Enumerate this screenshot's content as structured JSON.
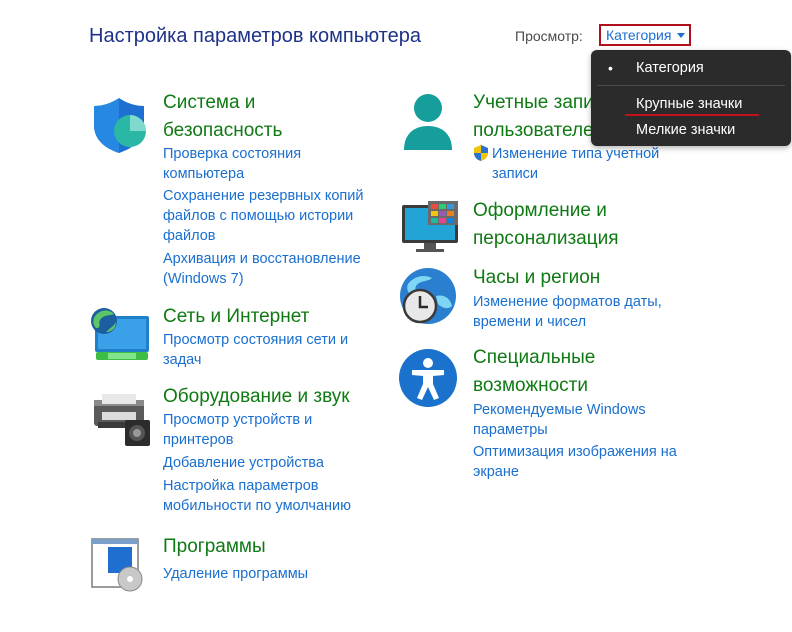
{
  "header": {
    "title": "Настройка параметров компьютера",
    "view_label": "Просмотр:",
    "view_value": "Категория"
  },
  "view_menu": {
    "options": [
      "Категория",
      "Крупные значки",
      "Мелкие значки"
    ]
  },
  "categories": [
    {
      "title": [
        "Система и",
        "безопасность"
      ],
      "links": [
        [
          "Проверка состояния",
          "компьютера"
        ],
        [
          "Сохранение резервных копий",
          "файлов с помощью истории",
          "файлов"
        ],
        [
          "Архивация и восстановление",
          "(Windows 7)"
        ]
      ]
    },
    {
      "title": [
        "Сеть и Интернет"
      ],
      "links": [
        [
          "Просмотр состояния сети и",
          "задач"
        ]
      ]
    },
    {
      "title": [
        "Оборудование и звук"
      ],
      "links": [
        [
          "Просмотр устройств и",
          "принтеров"
        ],
        [
          "Добавление устройства"
        ],
        [
          "Настройка параметров",
          "мобильности по умолчанию"
        ]
      ]
    },
    {
      "title": [
        "Программы"
      ],
      "links": [
        [
          "Удаление программы"
        ]
      ]
    },
    {
      "title": [
        "Учетные записи",
        "пользователей"
      ],
      "links": [
        [
          "Изменение типа учетной",
          "записи"
        ]
      ]
    },
    {
      "title": [
        "Оформление и",
        "персонализация"
      ],
      "links": []
    },
    {
      "title": [
        "Часы и регион"
      ],
      "links": [
        [
          "Изменение форматов даты,",
          "времени и чисел"
        ]
      ]
    },
    {
      "title": [
        "Специальные",
        "возможности"
      ],
      "links": [
        [
          "Рекомендуемые Windows",
          "параметры"
        ],
        [
          "Оптимизация изображения на",
          "экране"
        ]
      ]
    }
  ]
}
